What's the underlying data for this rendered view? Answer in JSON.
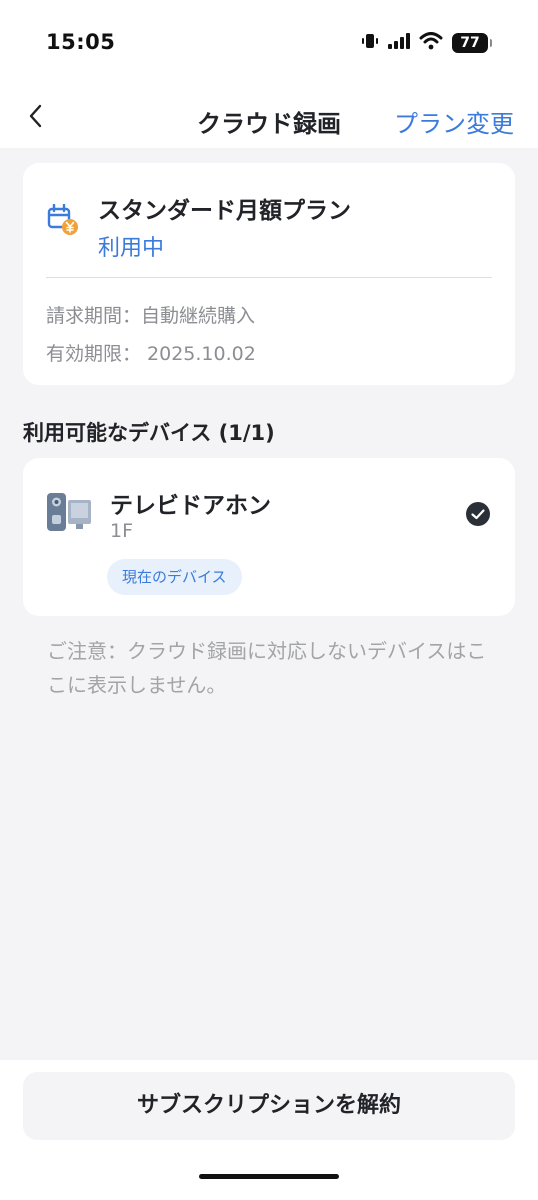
{
  "status_bar": {
    "time": "15:05",
    "battery": "77",
    "icons": [
      "vibrate-icon",
      "signal-icon",
      "wifi-icon",
      "battery-icon"
    ]
  },
  "nav": {
    "back_icon": "chevron-left-icon",
    "title": "クラウド録画",
    "plan_change": "プラン変更",
    "accent_color": "#3a7bdc"
  },
  "plan": {
    "icon": "calendar-yen-icon",
    "name": "スタンダード月額プラン",
    "status": "利用中",
    "billing": "請求期間：自動継続購入",
    "expiry": "有効期限： 2025.10.02"
  },
  "devices": {
    "heading": "利用可能なデバイス (1/1)",
    "items": [
      {
        "icon": "doorbell-device-icon",
        "name": "テレビドアホン",
        "location": "1F",
        "badge": "現在のデバイス",
        "selected": true
      }
    ]
  },
  "notice": "ご注意：クラウド録画に対応しないデバイスはここに表示しません。",
  "footer": {
    "cancel_button": "サブスクリプションを解約"
  }
}
